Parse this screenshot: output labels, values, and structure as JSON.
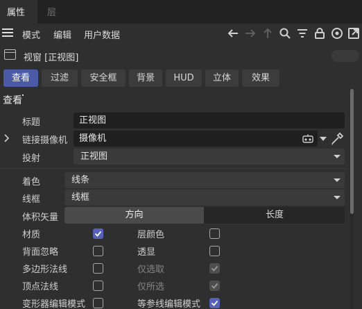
{
  "tabs": {
    "attributes": "属性",
    "layers": "层"
  },
  "menu": {
    "mode": "模式",
    "edit": "编辑",
    "user_data": "用户数据"
  },
  "toolbar_icons": [
    "menu-icon",
    "back-arrow-icon",
    "forward-arrow-icon",
    "up-arrow-icon",
    "search-icon",
    "filter-icon",
    "lock-icon",
    "target-icon",
    "open-external-icon"
  ],
  "view_header": {
    "title": "视窗 [正视图]"
  },
  "chips": [
    "查看",
    "过滤",
    "安全框",
    "背景",
    "HUD",
    "立体",
    "效果"
  ],
  "active_chip": "查看",
  "section_title": "查看",
  "fields": {
    "title": {
      "label": "标题",
      "value": "正视图"
    },
    "camera": {
      "label": "链接摄像机",
      "value": "摄像机"
    },
    "projection": {
      "label": "投射",
      "value": "正视图"
    },
    "shading": {
      "label": "着色",
      "value": "线条"
    },
    "wireframe": {
      "label": "线框",
      "value": "线框"
    },
    "volume_vector": {
      "label": "体积矢量",
      "options": [
        "方向",
        "长度"
      ],
      "selected": "方向"
    }
  },
  "checkboxes": {
    "material": {
      "label": "材质",
      "checked": true
    },
    "layer_color": {
      "label": "层颜色",
      "checked": false
    },
    "backface": {
      "label": "背面忽略",
      "checked": false
    },
    "xray": {
      "label": "透显",
      "checked": false
    },
    "poly_normals": {
      "label": "多边形法线",
      "checked": false
    },
    "only_selected": {
      "label": "仅选取",
      "checked": true,
      "disabled": true
    },
    "vertex_normals": {
      "label": "顶点法线",
      "checked": false
    },
    "only_selected2": {
      "label": "仅所选",
      "checked": true,
      "disabled": true
    },
    "deformer_edit": {
      "label": "变形器编辑模式",
      "checked": false
    },
    "isoparm_edit": {
      "label": "等参线编辑模式",
      "checked": true
    }
  },
  "colors": {
    "accent": "#4b5aa6",
    "checkbox_on": "#5562b7",
    "background": "#2f2f2f"
  }
}
